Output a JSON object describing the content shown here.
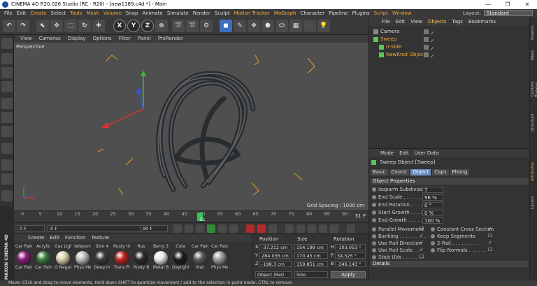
{
  "window": {
    "title": "CINEMA 4D R20.026 Studio (RC - R20) - [new1189.c4d *] - Main",
    "controls": [
      "—",
      "❐",
      "✕"
    ]
  },
  "menubar": {
    "items": [
      "File",
      "Edit",
      "Create",
      "Select",
      "Tools",
      "Mesh",
      "Volume",
      "Snap",
      "Animate",
      "Simulate",
      "Render",
      "Sculpt",
      "Motion Tracker",
      "MoGraph",
      "Character",
      "Pipeline",
      "Plugins",
      "Script",
      "Window"
    ],
    "highlight": [
      "Create",
      "Tools",
      "Mesh",
      "Volume",
      "Motion Tracker",
      "MoGraph",
      "Script",
      "Window"
    ],
    "layout_label": "Layout:",
    "layout_value": "Standard"
  },
  "toolbar": {
    "axes": [
      "X",
      "Y",
      "Z"
    ]
  },
  "viewport": {
    "menu": [
      "View",
      "Cameras",
      "Display",
      "Options",
      "Filter",
      "Panel",
      "ProRender"
    ],
    "label": "Perspective",
    "grid_spacing": "Grid Spacing : 1000 cm"
  },
  "timeline": {
    "ticks": [
      "0",
      "5",
      "10",
      "15",
      "20",
      "25",
      "30",
      "35",
      "40",
      "45",
      "50",
      "55",
      "60",
      "65",
      "70",
      "75",
      "80",
      "85",
      "90"
    ],
    "current_frame": "51",
    "end_label": "51 F"
  },
  "playback": {
    "start": "0 F",
    "preview_start": "0 F",
    "preview_end": "90 F",
    "end": "90 F"
  },
  "materials": {
    "menu": [
      "Create",
      "Edit",
      "Function",
      "Texture"
    ],
    "items": [
      {
        "name": "Car Pain",
        "color": "#8a1a7a"
      },
      {
        "name": "Acrylic",
        "color": "#3a7a3a"
      },
      {
        "name": "Gas Ligh",
        "color": "#d7d0a8"
      },
      {
        "name": "teleport",
        "color": "#b9b9b9"
      },
      {
        "name": "Skin 4",
        "color": "#3a3a3a"
      },
      {
        "name": "Rusty Iri",
        "color": "#c12222"
      },
      {
        "name": "Rus",
        "color": "#2a2a2a"
      },
      {
        "name": "Berry 3",
        "color": "#e8e8e8"
      },
      {
        "name": "Cola",
        "color": "#1e1e1e"
      },
      {
        "name": "Car Pain",
        "color": "#5a5a5a"
      },
      {
        "name": "Car Pain",
        "color": "#9a9a9a"
      }
    ],
    "names2": [
      "Car Pain",
      "Car Pain",
      "G Negat",
      "Phys Me",
      "Deep m",
      "Trans Pl",
      "Rusty B",
      "Metal B",
      "Daylight",
      "Mat",
      "Phys Me"
    ]
  },
  "coords": {
    "headers": [
      "Position",
      "Size",
      "Rotation"
    ],
    "rows": [
      {
        "axis": "X",
        "pos": "-37.212 cm",
        "size": "154.199 cm",
        "rot_axis": "H",
        "rot": "-103.053 °"
      },
      {
        "axis": "Y",
        "pos": "284.035 cm",
        "size": "170.45 cm",
        "rot_axis": "P",
        "rot": "34.525 °"
      },
      {
        "axis": "Z",
        "pos": "-198.3 cm",
        "size": "159.851 cm",
        "rot_axis": "B",
        "rot": "-346.143 °"
      }
    ],
    "mode": "Object (Rel)",
    "size_mode": "Size",
    "apply": "Apply"
  },
  "object_manager": {
    "menu": [
      "File",
      "Edit",
      "View",
      "Objects",
      "Tags",
      "Bookmarks"
    ],
    "active_tab": "Objects",
    "objects": [
      {
        "name": "Camera",
        "selected": false
      },
      {
        "name": "Sweep",
        "selected": true
      },
      {
        "name": "n-Side",
        "selected": true
      },
      {
        "name": "NewKnot Object",
        "selected": true
      }
    ]
  },
  "attributes": {
    "menu": [
      "Mode",
      "Edit",
      "User Data"
    ],
    "object_title": "Sweep Object [Sweep]",
    "tabs": [
      "Basic",
      "Coord.",
      "Object",
      "Caps",
      "Phong"
    ],
    "active_tab": "Object",
    "section": "Object Properties",
    "props": [
      {
        "label": "Isoparm Subdivision",
        "value": "7"
      },
      {
        "label": "End Scale . . . . . . . .",
        "value": "96 %"
      },
      {
        "label": "End Rotation . . . . . .",
        "value": "0 °"
      },
      {
        "label": "Start Growth . . . . . .",
        "value": "0 %"
      },
      {
        "label": "End Growth . . . . . . .",
        "value": "100 %"
      }
    ],
    "checks_left": [
      {
        "label": "Parallel Movement",
        "checked": false
      },
      {
        "label": "Banking . . . . . . . . .",
        "checked": true
      },
      {
        "label": "Use Rail Direction",
        "checked": true
      },
      {
        "label": "Use Rail Scale . .",
        "checked": true
      },
      {
        "label": "Stick UVs . . . . . . .",
        "checked": false
      }
    ],
    "checks_right": [
      {
        "label": "Constant Cross Section",
        "checked": true
      },
      {
        "label": "Keep Segments",
        "checked": false
      },
      {
        "label": "2-Rail . . . . . . . . .",
        "checked": true
      },
      {
        "label": "Flip Normals . . . . . .",
        "checked": false
      }
    ],
    "details": "Details"
  },
  "right_tabs": [
    "Objects",
    "Takes",
    "Content Browser",
    "Structure",
    "Attributes",
    "Layers"
  ],
  "status": "Move: Click and drag to move elements. Hold down SHIFT to quantize movement / add to the selection in point mode, CTRL to remove.",
  "brand": "MAXON CINEMA 4D"
}
